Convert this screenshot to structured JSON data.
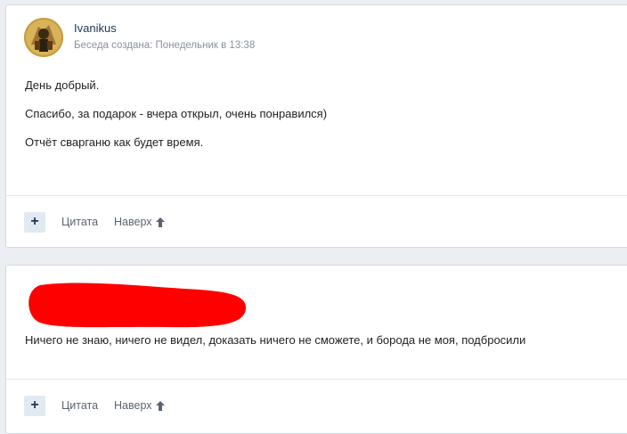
{
  "post1": {
    "author_name": "Ivanikus",
    "date_text": "Беседа создана: Понедельник в 13:38",
    "paragraphs": [
      "День добрый.",
      "Спасибо, за подарок - вчера открыл, очень понравился)",
      "Отчёт сварганю как будет время."
    ],
    "footer": {
      "plus_label": "+",
      "quote_label": "Цитата",
      "top_label": "Наверх"
    }
  },
  "post2": {
    "text": "Ничего не знаю, ничего не видел, доказать ничего не сможете, и борода не моя, подбросили",
    "footer": {
      "plus_label": "+",
      "quote_label": "Цитата",
      "top_label": "Наверх"
    }
  },
  "colors": {
    "redaction": "#ff0000",
    "accent": "#1d3652"
  }
}
